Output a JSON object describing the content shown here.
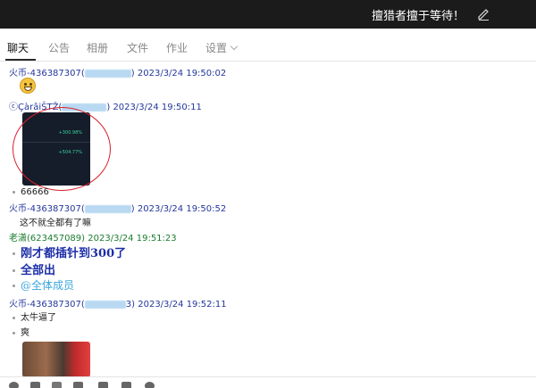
{
  "window": {
    "title": "擅猎者擅于等待！",
    "edit_icon": "pencil-icon"
  },
  "tabs": [
    {
      "label": "聊天",
      "active": true
    },
    {
      "label": "公告"
    },
    {
      "label": "相册"
    },
    {
      "label": "文件"
    },
    {
      "label": "作业"
    },
    {
      "label": "设置"
    }
  ],
  "messages": [
    {
      "sender": "火币-436387307(",
      "sender_close": ")",
      "time": "2023/3/24 19:50:02",
      "content": "[emoji]"
    },
    {
      "sender": "ⓒÇàrâiŠTŽ(",
      "sender_close": ")",
      "time": "2023/3/24 19:50:11",
      "content": "[image]"
    },
    {
      "text": "66666"
    },
    {
      "sender": "火币-436387307(",
      "sender_close": ")",
      "time": "2023/3/24 19:50:52"
    },
    {
      "text": "这不就全都有了嘛"
    },
    {
      "sender": "老潇(623457089)",
      "time": "2023/3/24 19:51:23"
    },
    {
      "text": "刚才都插针到300了"
    },
    {
      "text": "全部出"
    },
    {
      "text": "@全体成员"
    },
    {
      "sender": "火币-436387307(",
      "sender_close": "3)",
      "time": "2023/3/24 19:52:11"
    },
    {
      "text": "太牛逼了"
    },
    {
      "text": "爽"
    }
  ],
  "screenshot_values": [
    "+300.98%",
    "+504.77%"
  ],
  "colors": {
    "sender": "#23379b",
    "sender_green": "#1b7c2f",
    "annotation": "#d8202a",
    "titlebar": "#1b1b1b"
  }
}
